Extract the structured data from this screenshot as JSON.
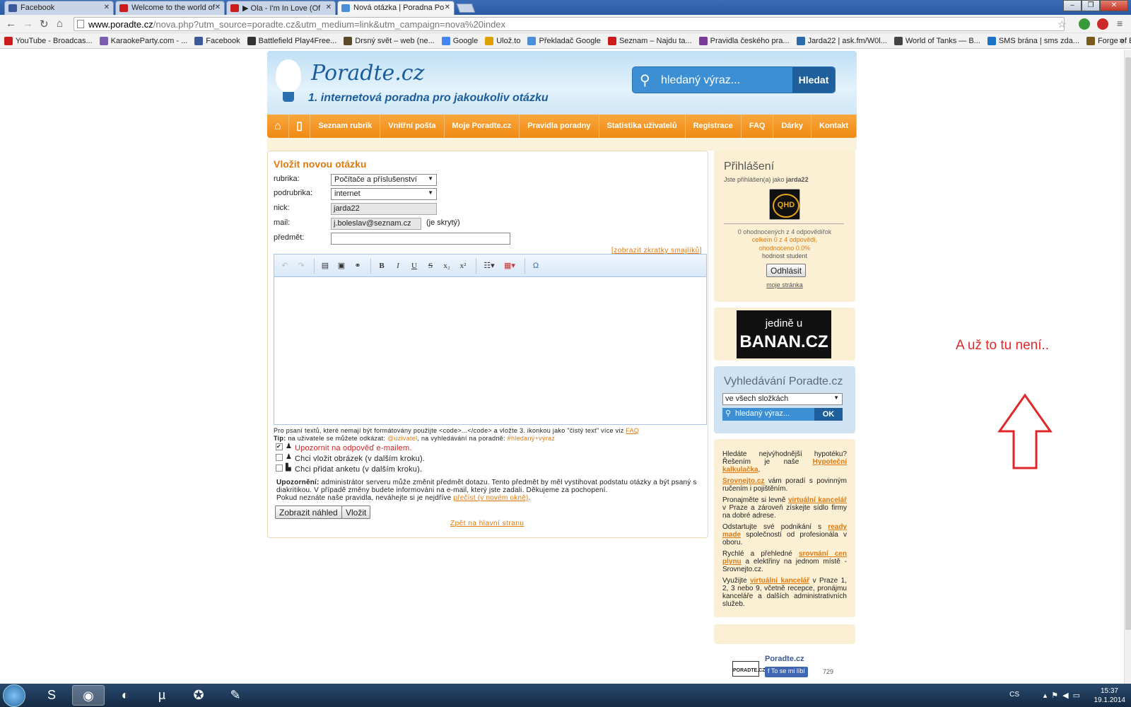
{
  "browser": {
    "tabs": [
      {
        "label": "Facebook",
        "fav_color": "#3b5998"
      },
      {
        "label": "Welcome to the world of",
        "fav_color": "#cc1b1b"
      },
      {
        "label": "▶ Ola - I'm In Love (Of",
        "fav_color": "#cc1b1b"
      },
      {
        "label": "Nová otázka | Poradna Po",
        "fav_color": "#4a90d9"
      }
    ],
    "url_host": "www.poradte.cz",
    "url_rest": "/nova.php?utm_source=poradte.cz&utm_medium=link&utm_campaign=nova%20index",
    "bookmarks": [
      {
        "label": "YouTube - Broadcas...",
        "color": "#cc1b1b"
      },
      {
        "label": "KaraokeParty.com - ...",
        "color": "#7a5cb0"
      },
      {
        "label": "Facebook",
        "color": "#3b5998"
      },
      {
        "label": "Battlefield Play4Free...",
        "color": "#333333"
      },
      {
        "label": "Drsný svět – web (ne...",
        "color": "#5a4a2a"
      },
      {
        "label": "Google",
        "color": "#4285f4"
      },
      {
        "label": "Ulož.to",
        "color": "#e0a000"
      },
      {
        "label": "Překladač Google",
        "color": "#4a90d9"
      },
      {
        "label": "Seznam – Najdu ta...",
        "color": "#cc1b1b"
      },
      {
        "label": "Pravidla českého pra...",
        "color": "#7a3a9a"
      },
      {
        "label": "Jarda22 | ask.fm/W0l...",
        "color": "#2a6aa8"
      },
      {
        "label": "World of Tanks — B...",
        "color": "#444444"
      },
      {
        "label": "SMS brána | sms zda...",
        "color": "#1a73c8"
      },
      {
        "label": "Forge of Empires",
        "color": "#7a5a1a"
      }
    ]
  },
  "site": {
    "logo_title": "Poradte.cz",
    "tagline": "1. internetová poradna pro jakoukoliv otázku",
    "search_placeholder": "hledaný výraz...",
    "search_button": "Hledat",
    "nav": [
      "Seznam rubrik",
      "Vnitřní pošta",
      "Moje Poradte.cz",
      "Pravidla poradny",
      "Statistika uživatelů",
      "Registrace",
      "FAQ",
      "Dárky",
      "Kontakt"
    ]
  },
  "form": {
    "title": "Vložit novou otázku",
    "rubrika_label": "rubrika:",
    "rubrika_value": "Počítače a příslušenství",
    "podrubrika_label": "podrubrika:",
    "podrubrika_value": "internet",
    "nick_label": "nick:",
    "nick_value": "jarda22",
    "mail_label": "mail:",
    "mail_value": "j.boleslav@seznam.cz",
    "mail_hidden": "(je skrytý)",
    "predmet_label": "předmět:",
    "smileys_link": "[zobrazit zkratky smajlíků]",
    "note1_a": "Pro psaní textů, které nemají být formátovány použijte <code>...</code> a vložte 3. ikonkou jako \"čistý text\" více viz ",
    "note1_link": "FAQ",
    "note2_tip": "Tip:",
    "note2_a": " na uživatele se můžete odkázat: ",
    "note2_user": "@uzivatel",
    "note2_b": ", na vyhledávání na poradně: ",
    "note2_search": "#hledaný+výraz",
    "check1": "Upozornit na odpověď e-mailem.",
    "check2": "Chci vložit obrázek (v dalším kroku).",
    "check3": "Chci přidat anketu (v dalším kroku).",
    "warn_bold": "Upozornění:",
    "warn_text": " administrátor serveru může změnit předmět dotazu. Tento předmět by měl vystihovat podstatu otázky a být psaný s diakritikou. V případě změny budete informováni na e-mail, který jste zadali. Děkujeme za pochopení.",
    "warn_text2": "Pokud neznáte naše pravidla, neváhejte si je nejdříve ",
    "warn_link": "přečíst (v novém okně)",
    "preview_button": "Zobrazit náhled",
    "submit_button": "Vložit",
    "back_link": "Zpět na hlavní stranu"
  },
  "sidebar": {
    "login_title": "Přihlášení",
    "logged_as": "Jste přihlášen(a) jako ",
    "user": "jarda22",
    "stat1": "0 ohodnocených z 4 odpovědířok",
    "stat2": "celkem 0 z 4 odpovědí,",
    "stat3": "ohodnoceno 0.0%",
    "stat4": "hodnost student",
    "logout_button": "Odhlásit",
    "my_page": "moje stránka",
    "banner_line1": "jedině u",
    "banner_line2": "BANAN.CZ",
    "search_title": "Vyhledávání Poradte.cz",
    "search_scope": "ve všech složkách",
    "search_placeholder": "hledaný výraz...",
    "search_ok": "OK",
    "ads": [
      {
        "pre": "Hledáte nejvýhodnější hypotéku? Řešením je naše ",
        "link": "Hypoteční kalkulačka",
        "post": "."
      },
      {
        "pre": "",
        "link": "Srovnejto.cz",
        "post": " vám poradí s povinným ručením i pojištěním."
      },
      {
        "pre": "Pronajměte si levně ",
        "link": "virtuální kancelář",
        "post": " v Praze a zároveň získejte sídlo firmy na dobré adrese."
      },
      {
        "pre": "Odstartujte své podnikání s ",
        "link": "ready made",
        "post": " společností od profesionála v oboru."
      },
      {
        "pre": "Rychlé a přehledné ",
        "link": "srovnání cen plynu",
        "post": " a elektřiny na jednom místě - Srovnejto.cz."
      },
      {
        "pre": "Využijte ",
        "link": "virtuální kancelář",
        "post": " v Praze 1, 2, 3 nebo 9, včetně recepce, pronájmu kanceláře a dalších administrativních služeb."
      }
    ],
    "fb_name": "Poradte.cz",
    "fb_like": "To se mi líbí",
    "fb_count": "729",
    "fb_logo_text": "PORADTE.CZ"
  },
  "annotation": {
    "text": "A už to tu není..",
    "color": "#e0282b"
  },
  "taskbar": {
    "lang": "CS",
    "time": "15:37",
    "date": "19.1.2014"
  }
}
